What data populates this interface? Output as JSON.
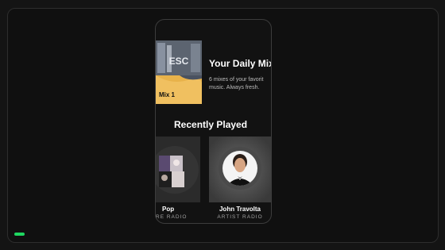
{
  "progress": {
    "value": 0.23,
    "color": "#1ed760"
  },
  "daily_mix": {
    "title": "Your Daily Mix",
    "description_line1": "6 mixes of your favorit",
    "description_line2": "music. Always fresh.",
    "cover_label": "Mix 1",
    "cover_text": "ESC"
  },
  "recently_played": {
    "title": "Recently Played",
    "items": [
      {
        "name": "Pop",
        "subtitle": "RE RADIO"
      },
      {
        "name": "John Travolta",
        "subtitle": "ARTIST RADIO"
      }
    ]
  }
}
